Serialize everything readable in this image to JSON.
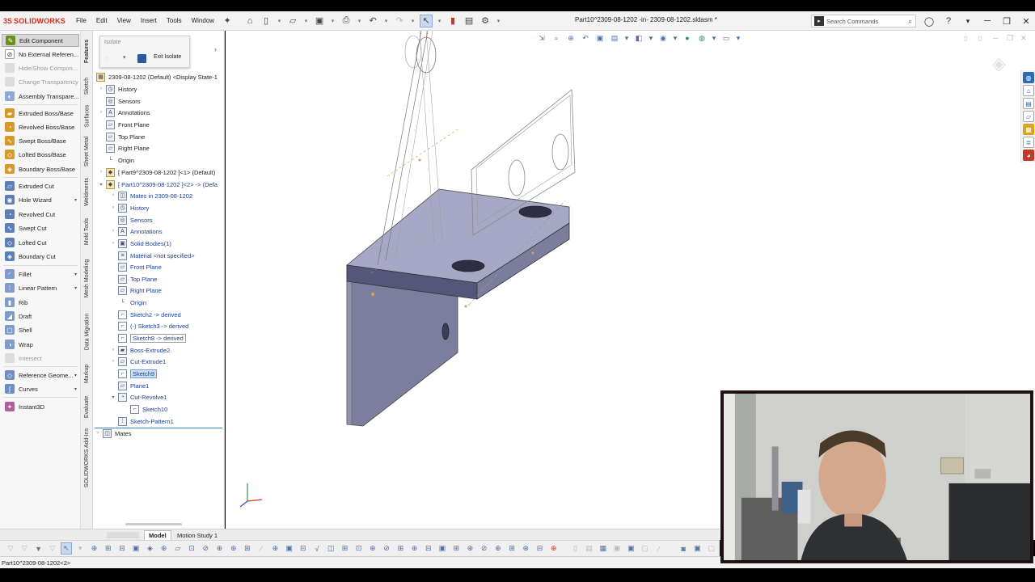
{
  "app": {
    "logo_prefix": "3S",
    "logo_text": "SOLIDWORKS",
    "document_title": "Part10^2309-08-1202 -in- 2309-08-1202.sldasm *"
  },
  "menu": [
    "File",
    "Edit",
    "View",
    "Insert",
    "Tools",
    "Window"
  ],
  "search": {
    "placeholder": "Search Commands"
  },
  "command_manager": {
    "edit_component": "Edit Component",
    "no_external_refs": "No External Referen...",
    "hide_show": "Hide/Show Compon...",
    "change_transparency": "Change Transparency",
    "assembly_transparency": "Assembly Transpare...",
    "extruded_boss": "Extruded Boss/Base",
    "revolved_boss": "Revolved Boss/Base",
    "swept_boss": "Swept Boss/Base",
    "lofted_boss": "Lofted Boss/Base",
    "boundary_boss": "Boundary Boss/Base",
    "extruded_cut": "Extruded Cut",
    "hole_wizard": "Hole Wizard",
    "revolved_cut": "Revolved Cut",
    "swept_cut": "Swept Cut",
    "lofted_cut": "Lofted Cut",
    "boundary_cut": "Boundary Cut",
    "fillet": "Fillet",
    "linear_pattern": "Linear Pattern",
    "rib": "Rib",
    "draft": "Draft",
    "shell": "Shell",
    "wrap": "Wrap",
    "intersect": "Intersect",
    "reference_geometry": "Reference Geome...",
    "curves": "Curves",
    "instant3d": "Instant3D"
  },
  "vertical_tabs": [
    "Features",
    "Sketch",
    "Surfaces",
    "Sheet Metal",
    "Weldments",
    "Mold Tools",
    "Mesh Modeling",
    "Data Migration",
    "Markup",
    "Evaluate",
    "SOLIDWORKS Add-Ins"
  ],
  "isolate_popup": {
    "title": "Isolate",
    "exit_label": "Exit Isolate"
  },
  "tree": {
    "root": "2309-08-1202 (Default) <Display State-1",
    "history": "History",
    "sensors": "Sensors",
    "annotations": "Annotations",
    "front_plane": "Front Plane",
    "top_plane": "Top Plane",
    "right_plane": "Right Plane",
    "origin": "Origin",
    "part9": "[ Part9^2309-08-1202 ]<1> (Default)",
    "part10": "[ Part10^2309-08-1202 ]<2> -> (Defa",
    "mates_in": "Mates in 2309-08-1202",
    "sub_history": "History",
    "sub_sensors": "Sensors",
    "sub_annotations": "Annotations",
    "solid_bodies": "Solid Bodies(1)",
    "material": "Material <not specified>",
    "sub_front_plane": "Front Plane",
    "sub_top_plane": "Top Plane",
    "sub_right_plane": "Right Plane",
    "sub_origin": "Origin",
    "sketch2": "Sketch2 -> derived",
    "sketch3": "(-) Sketch3 -> derived",
    "sketch8": "Sketch8 -> derived",
    "boss_extrude2": "Boss-Extrude2",
    "cut_extrude1": "Cut-Extrude1",
    "sketch9": "Sketch9",
    "plane1": "Plane1",
    "cut_revolve1": "Cut-Revolve1",
    "sketch10": "Sketch10",
    "sketch_pattern1": "Sketch-Pattern1",
    "mates": "Mates"
  },
  "bottom_tabs": {
    "model": "Model",
    "motion_study": "Motion Study 1"
  },
  "status": {
    "text": "Part10^2309-08-1202<2>"
  },
  "colors": {
    "part_face_top": "#a7a8c6",
    "part_face_side": "#6d6e8d",
    "selection_blue": "#cde0f7",
    "brand_red": "#d52b1e"
  }
}
